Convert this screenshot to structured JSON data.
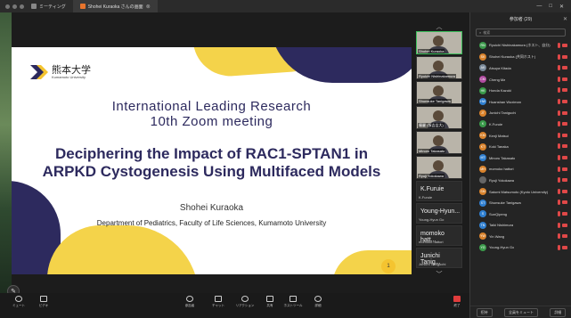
{
  "titlebar": {
    "tabs": [
      {
        "label": "ミーティング"
      },
      {
        "label": "Shohei Kuraoka さんの画面",
        "close": "⊗"
      }
    ]
  },
  "slide": {
    "logo_jp": "熊本大学",
    "logo_en": "Kumamoto University",
    "line1": "International Leading Research",
    "line2": "10th Zoom meeting",
    "title1": "Deciphering the Impact of RAC1-SPTAN1 in",
    "title2": "ARPKD Cystogenesis Using Multifaced Models",
    "author": "Shohei Kuraoka",
    "dept": "Department of Pediatrics, Faculty of Life Sciences, Kumamoto University",
    "page": "1",
    "colors": {
      "navy": "#2d2a5e",
      "yellow": "#f4d34a"
    }
  },
  "thumbnails": [
    {
      "name": "Shohei Kuraoka"
    },
    {
      "name": "Ryuichi Nishinakamura"
    },
    {
      "name": "Shunsuke Tanigawa"
    },
    {
      "name": "瞳麗 (張吉吉大)"
    },
    {
      "name": "Minoru Takasato"
    },
    {
      "name": "Ryuji Yokokawa"
    }
  ],
  "nameboxes": [
    {
      "big": "K.Furuie",
      "small": "K.Furuie"
    },
    {
      "big": "Young-Hyun...",
      "small": "Young-Hyun Go"
    },
    {
      "big": "momoko hatt...",
      "small": "momoko hattori"
    },
    {
      "big": "Junichi Tanig...",
      "small": "Junichi Taniguchi"
    }
  ],
  "panel": {
    "title": "参加者 (29)",
    "search_placeholder": "検索",
    "participants": [
      {
        "initials": "RN",
        "name": "Ryuichi Nishinakamura (ホスト、自分)",
        "color": "#3a9a4a"
      },
      {
        "initials": "SK",
        "name": "Shohei Kuraoka (共同ホスト)",
        "color": "#d9822b"
      },
      {
        "initials": "AK",
        "name": "Atsuya Kitada",
        "color": "#7a8a9a"
      },
      {
        "initials": "CM",
        "name": "Cheng Ma",
        "color": "#b04aa0"
      },
      {
        "initials": "HK",
        "name": "Honda Kazuki",
        "color": "#3a9a4a"
      },
      {
        "initials": "HW",
        "name": "Huanshan Wuximan",
        "color": "#2f7fd0"
      },
      {
        "initials": "JT",
        "name": "Junichi Taniguchi",
        "color": "#d9822b"
      },
      {
        "initials": "K",
        "name": "K.Furuie",
        "color": "#3a9a4a"
      },
      {
        "initials": "KM",
        "name": "Kenji Matsui",
        "color": "#d9822b"
      },
      {
        "initials": "KT",
        "name": "Koki Tanaka",
        "color": "#d9822b"
      },
      {
        "initials": "MT",
        "name": "Minoru Takasato",
        "color": "#2f7fd0"
      },
      {
        "initials": "MH",
        "name": "momoko hattori",
        "color": "#d9822b"
      },
      {
        "initials": "",
        "name": "Ryuji Yokokawa",
        "color": "#666666"
      },
      {
        "initials": "SM",
        "name": "Satomi Matsumoto (Kyoto University)",
        "color": "#d9822b"
      },
      {
        "initials": "ST",
        "name": "Shunsuke Tanigawa",
        "color": "#2f7fd0"
      },
      {
        "initials": "S",
        "name": "SunQipeng",
        "color": "#2f7fd0"
      },
      {
        "initials": "TN",
        "name": "Taiki Nishimura",
        "color": "#2f7fd0"
      },
      {
        "initials": "YW",
        "name": "Yin Wang",
        "color": "#d9822b"
      },
      {
        "initials": "YG",
        "name": "Young-Hyun Go",
        "color": "#3a9a4a"
      }
    ],
    "footer": [
      "招待",
      "全員をミュート",
      "詳細"
    ]
  },
  "toolbar": {
    "items": [
      {
        "label": "ミュート"
      },
      {
        "label": "ビデオ"
      },
      {
        "label": "参加者"
      },
      {
        "label": "チャット"
      },
      {
        "label": "リアクション"
      },
      {
        "label": "共有"
      },
      {
        "label": "ホストツール"
      },
      {
        "label": "詳細"
      },
      {
        "label": "終了"
      }
    ]
  }
}
